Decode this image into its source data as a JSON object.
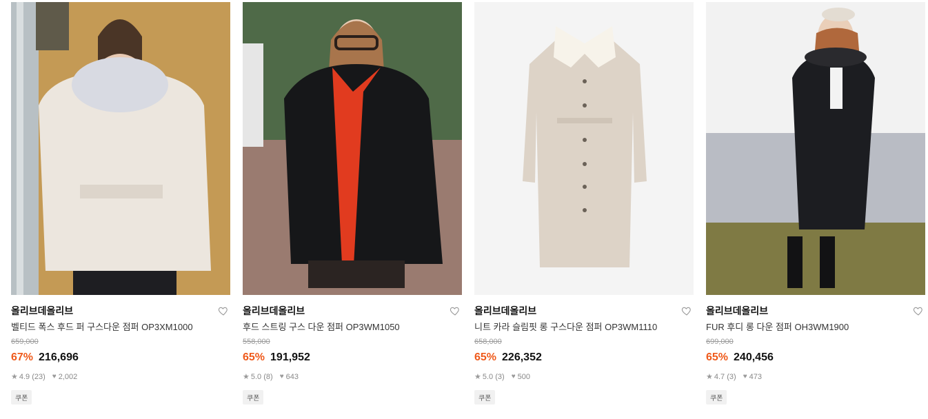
{
  "products": [
    {
      "brand": "올리브데올리브",
      "title": "벨티드 폭스 후드 퍼 구스다운 점퍼 OP3XM1000",
      "original_price": "659,000",
      "discount": "67%",
      "price": "216,696",
      "rating": "4.9",
      "reviews": "(23)",
      "likes": "2,002",
      "badge": "쿠폰",
      "image_desc": "model-white-fur-hood-down-jacket"
    },
    {
      "brand": "올리브데올리브",
      "title": "후드 스트링 구스 다운 점퍼 OP3WM1050",
      "original_price": "558,000",
      "discount": "65%",
      "price": "191,952",
      "rating": "5.0",
      "reviews": "(8)",
      "likes": "643",
      "badge": "쿠폰",
      "image_desc": "model-black-hooded-down-jacket-red-scarf"
    },
    {
      "brand": "올리브데올리브",
      "title": "니트 카라 슬림핏 롱 구스다운 점퍼 OP3WM1110",
      "original_price": "658,000",
      "discount": "65%",
      "price": "226,352",
      "rating": "5.0",
      "reviews": "(3)",
      "likes": "500",
      "badge": "쿠폰",
      "image_desc": "beige-long-down-coat-knit-collar"
    },
    {
      "brand": "올리브데올리브",
      "title": "FUR 후디 롱 다운 점퍼 OH3WM1900",
      "original_price": "699,000",
      "discount": "65%",
      "price": "240,456",
      "rating": "4.7",
      "reviews": "(3)",
      "likes": "473",
      "badge": "쿠폰",
      "image_desc": "model-black-long-fur-hooded-down-coat"
    }
  ],
  "colors": {
    "discount": "#ef5a1b",
    "text": "#111111",
    "muted": "#888888"
  }
}
